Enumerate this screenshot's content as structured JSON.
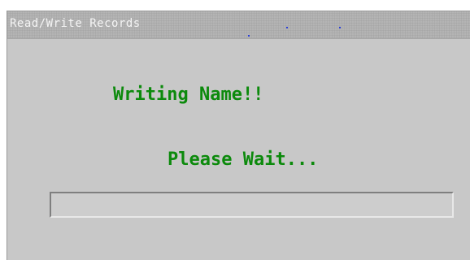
{
  "window": {
    "title": "Read/Write Records"
  },
  "message": {
    "line1": "Writing Name!!",
    "line2": "Please Wait..."
  },
  "progress": {
    "value_fraction": 0.0
  },
  "colors": {
    "window_bg": "#c8c8c8",
    "titlebar_bg": "#b4b4b4",
    "title_text": "#f4f4f4",
    "message_text": "#0c8a0c",
    "progress_fill": "#2a3fd8"
  }
}
